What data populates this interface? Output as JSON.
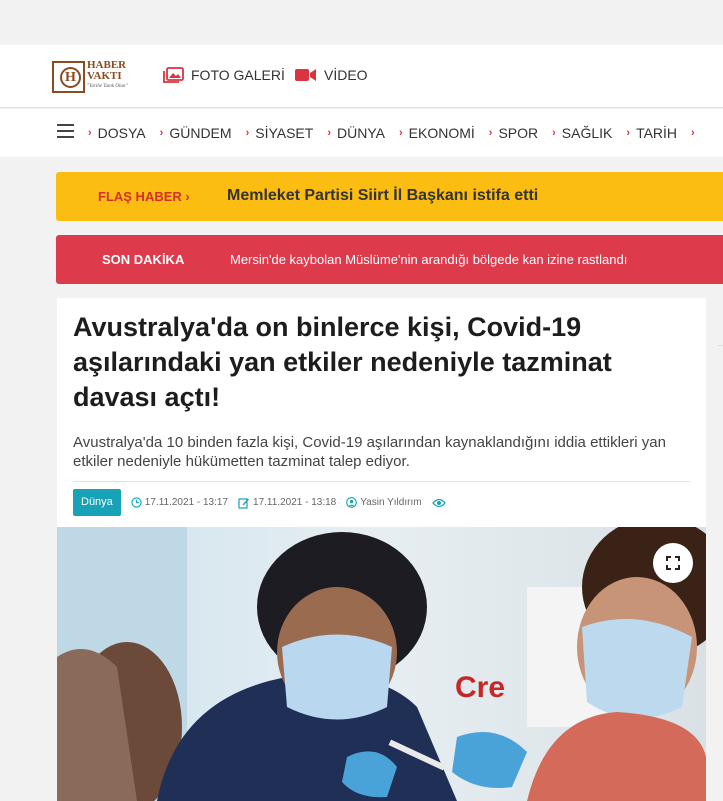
{
  "header": {
    "logo": {
      "line1": "HABER",
      "line2": "VAKTI",
      "tagline": "\"Tarihe Tanık Olun\""
    },
    "links": [
      {
        "label": "FOTO GALERİ",
        "icon": "photo-gallery-icon"
      },
      {
        "label": "VİDEO",
        "icon": "video-icon"
      }
    ]
  },
  "nav": {
    "items": [
      "DOSYA",
      "GÜNDEM",
      "SİYASET",
      "DÜNYA",
      "EKONOMİ",
      "SPOR",
      "SAĞLIK",
      "TARİH"
    ]
  },
  "flash": {
    "label": "FLAŞ HABER ›",
    "text": "Memleket Partisi Siirt İl Başkanı istifa etti"
  },
  "breaking": {
    "label": "SON DAKİKA",
    "text": "Mersin'de kaybolan Müslüme'nin arandığı bölgede kan izine rastlandı"
  },
  "article": {
    "title": "Avustralya'da on binlerce kişi, Covid-19 aşılarındaki yan etkiler nedeniyle tazminat davası açtı!",
    "summary": "Avustralya'da 10 binden fazla kişi, Covid-19 aşılarından kaynaklandığını iddia ettikleri yan etkiler nedeniyle hükümetten tazminat talep ediyor.",
    "category": "Dünya",
    "published": "17.11.2021 - 13:17",
    "updated": "17.11.2021 - 13:18",
    "author": "Yasin Yıldırım"
  },
  "colors": {
    "flash_bg": "#fbbd12",
    "breaking_bg": "#dd3a4c",
    "category_bg": "#17a2b8",
    "accent": "#d32f2f"
  }
}
